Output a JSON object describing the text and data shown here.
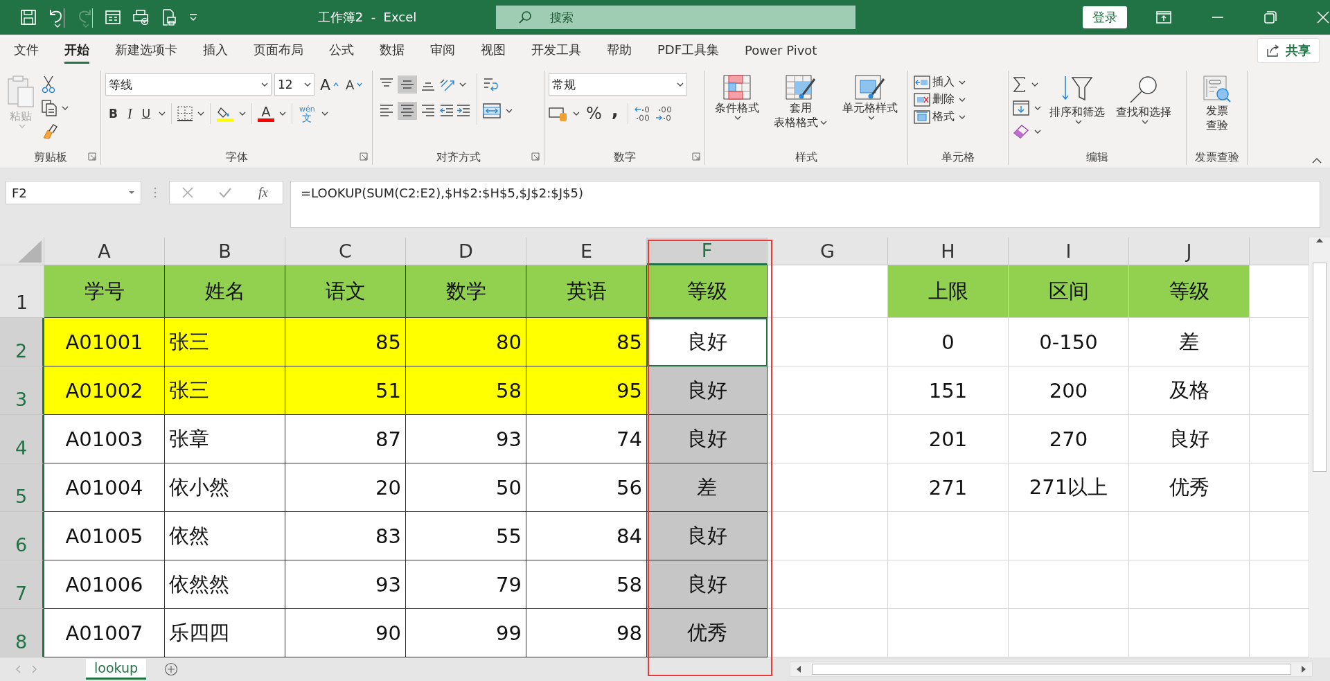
{
  "title_bar": {
    "title": "工作簿2  -  Excel",
    "search": {
      "placeholder": "搜索"
    },
    "sign_in": "登录"
  },
  "menu_tabs": [
    {
      "label": "文件",
      "selected": false
    },
    {
      "label": "开始",
      "selected": true
    },
    {
      "label": "新建选项卡",
      "selected": false
    },
    {
      "label": "插入",
      "selected": false
    },
    {
      "label": "页面布局",
      "selected": false
    },
    {
      "label": "公式",
      "selected": false
    },
    {
      "label": "数据",
      "selected": false
    },
    {
      "label": "审阅",
      "selected": false
    },
    {
      "label": "视图",
      "selected": false
    },
    {
      "label": "开发工具",
      "selected": false
    },
    {
      "label": "帮助",
      "selected": false
    },
    {
      "label": "PDF工具集",
      "selected": false
    },
    {
      "label": "Power Pivot",
      "selected": false
    }
  ],
  "share": "共享",
  "ribbon": {
    "clipboard": {
      "label": "剪贴板",
      "paste": "粘贴",
      "paste_disabled": true
    },
    "font": {
      "label": "字体",
      "font_name": "等线",
      "font_size": "12",
      "grow": "A",
      "shrink": "A",
      "bold": "B",
      "italic": "I",
      "underline": "U",
      "font_color": "A",
      "phonetic_top": "wén",
      "phonetic_bottom": "文"
    },
    "alignment": {
      "label": "对齐方式",
      "vertical": [
        {
          "selected": false
        },
        {
          "selected": true
        },
        {
          "selected": false
        }
      ],
      "horizontal": [
        {
          "selected": false
        },
        {
          "selected": true
        },
        {
          "selected": false
        }
      ]
    },
    "number": {
      "label": "数字",
      "format": "常规",
      "percent": "%",
      "comma": ","
    },
    "styles": {
      "label": "样式",
      "conditional": "条件格式",
      "table_line1": "套用",
      "table_line2": "表格格式",
      "cell_styles": "单元格样式"
    },
    "cells": {
      "label": "单元格",
      "insert": "插入",
      "delete": "删除",
      "format": "格式"
    },
    "editing": {
      "label": "编辑",
      "sort": "排序和筛选",
      "find": "查找和选择"
    },
    "invoice": {
      "label": "发票查验",
      "line1": "发票",
      "line2": "查验"
    }
  },
  "formula_bar": {
    "name_box": "F2",
    "fx": "fx",
    "formula": "=LOOKUP(SUM(C2:E2),$H$2:$H$5,$J$2:$J$5)"
  },
  "sheet": {
    "columns": [
      {
        "label": "A",
        "selected": false
      },
      {
        "label": "B",
        "selected": false
      },
      {
        "label": "C",
        "selected": false
      },
      {
        "label": "D",
        "selected": false
      },
      {
        "label": "E",
        "selected": false
      },
      {
        "label": "F",
        "selected": true
      },
      {
        "label": "G",
        "selected": false
      },
      {
        "label": "H",
        "selected": false
      },
      {
        "label": "I",
        "selected": false
      },
      {
        "label": "J",
        "selected": false
      }
    ],
    "rows": [
      {
        "number": "1",
        "selected": false,
        "cells": [
          {
            "text": "学号",
            "color": "#92d050",
            "selected": false,
            "active": false
          },
          {
            "text": "姓名",
            "color": "#92d050",
            "selected": false,
            "active": false
          },
          {
            "text": "语文",
            "color": "#92d050",
            "selected": false,
            "active": false
          },
          {
            "text": "数学",
            "color": "#92d050",
            "selected": false,
            "active": false
          },
          {
            "text": "英语",
            "color": "#92d050",
            "selected": false,
            "active": false
          },
          {
            "text": "等级",
            "color": "#92d050",
            "selected": false,
            "active": false
          },
          {
            "selected": false,
            "active": false
          },
          {
            "text": "上限",
            "color": "#92d050",
            "selected": false,
            "active": false
          },
          {
            "text": "区间",
            "color": "#92d050",
            "selected": false,
            "active": false
          },
          {
            "text": "等级",
            "color": "#92d050",
            "selected": false,
            "active": false
          }
        ]
      },
      {
        "number": "2",
        "selected": true,
        "cells": [
          {
            "text": "A01001",
            "color": "#ffff00",
            "selected": false,
            "active": false
          },
          {
            "text": "张三",
            "color": "#ffff00",
            "selected": false,
            "active": false
          },
          {
            "text": "85",
            "color": "#ffff00",
            "selected": false,
            "active": false
          },
          {
            "text": "80",
            "color": "#ffff00",
            "selected": false,
            "active": false
          },
          {
            "text": "85",
            "color": "#ffff00",
            "selected": false,
            "active": false
          },
          {
            "text": "良好",
            "selected": false,
            "active": true
          },
          {
            "selected": false,
            "active": false
          },
          {
            "text": "0",
            "selected": false,
            "active": false
          },
          {
            "text": "0-150",
            "selected": false,
            "active": false
          },
          {
            "text": "差",
            "selected": false,
            "active": false
          }
        ]
      },
      {
        "number": "3",
        "selected": true,
        "cells": [
          {
            "text": "A01002",
            "color": "#ffff00",
            "selected": false,
            "active": false
          },
          {
            "text": "张三",
            "color": "#ffff00",
            "selected": false,
            "active": false
          },
          {
            "text": "51",
            "color": "#ffff00",
            "selected": false,
            "active": false
          },
          {
            "text": "58",
            "color": "#ffff00",
            "selected": false,
            "active": false
          },
          {
            "text": "95",
            "color": "#ffff00",
            "selected": false,
            "active": false
          },
          {
            "text": "良好",
            "selected": true,
            "active": false
          },
          {
            "selected": false,
            "active": false
          },
          {
            "text": "151",
            "selected": false,
            "active": false
          },
          {
            "text": "200",
            "selected": false,
            "active": false
          },
          {
            "text": "及格",
            "selected": false,
            "active": false
          }
        ]
      },
      {
        "number": "4",
        "selected": true,
        "cells": [
          {
            "text": "A01003",
            "selected": false,
            "active": false
          },
          {
            "text": "张章",
            "selected": false,
            "active": false
          },
          {
            "text": "87",
            "selected": false,
            "active": false
          },
          {
            "text": "93",
            "selected": false,
            "active": false
          },
          {
            "text": "74",
            "selected": false,
            "active": false
          },
          {
            "text": "良好",
            "selected": true,
            "active": false
          },
          {
            "selected": false,
            "active": false
          },
          {
            "text": "201",
            "selected": false,
            "active": false
          },
          {
            "text": "270",
            "selected": false,
            "active": false
          },
          {
            "text": "良好",
            "selected": false,
            "active": false
          }
        ]
      },
      {
        "number": "5",
        "selected": true,
        "cells": [
          {
            "text": "A01004",
            "selected": false,
            "active": false
          },
          {
            "text": "依小然",
            "selected": false,
            "active": false
          },
          {
            "text": "20",
            "selected": false,
            "active": false
          },
          {
            "text": "50",
            "selected": false,
            "active": false
          },
          {
            "text": "56",
            "selected": false,
            "active": false
          },
          {
            "text": "差",
            "selected": true,
            "active": false
          },
          {
            "selected": false,
            "active": false
          },
          {
            "text": "271",
            "selected": false,
            "active": false
          },
          {
            "text": "271以上",
            "selected": false,
            "active": false
          },
          {
            "text": "优秀",
            "selected": false,
            "active": false
          }
        ]
      },
      {
        "number": "6",
        "selected": true,
        "cells": [
          {
            "text": "A01005",
            "selected": false,
            "active": false
          },
          {
            "text": "依然",
            "selected": false,
            "active": false
          },
          {
            "text": "83",
            "selected": false,
            "active": false
          },
          {
            "text": "55",
            "selected": false,
            "active": false
          },
          {
            "text": "84",
            "selected": false,
            "active": false
          },
          {
            "text": "良好",
            "selected": true,
            "active": false
          },
          {
            "selected": false,
            "active": false
          },
          {
            "selected": false,
            "active": false
          },
          {
            "selected": false,
            "active": false
          },
          {
            "selected": false,
            "active": false
          }
        ]
      },
      {
        "number": "7",
        "selected": true,
        "cells": [
          {
            "text": "A01006",
            "selected": false,
            "active": false
          },
          {
            "text": "依然然",
            "selected": false,
            "active": false
          },
          {
            "text": "93",
            "selected": false,
            "active": false
          },
          {
            "text": "79",
            "selected": false,
            "active": false
          },
          {
            "text": "58",
            "selected": false,
            "active": false
          },
          {
            "text": "良好",
            "selected": true,
            "active": false
          },
          {
            "selected": false,
            "active": false
          },
          {
            "selected": false,
            "active": false
          },
          {
            "selected": false,
            "active": false
          },
          {
            "selected": false,
            "active": false
          }
        ]
      },
      {
        "number": "8",
        "selected": true,
        "cells": [
          {
            "text": "A01007",
            "selected": false,
            "active": false
          },
          {
            "text": "乐四四",
            "selected": false,
            "active": false
          },
          {
            "text": "90",
            "selected": false,
            "active": false
          },
          {
            "text": "99",
            "selected": false,
            "active": false
          },
          {
            "text": "98",
            "selected": false,
            "active": false
          },
          {
            "text": "优秀",
            "selected": true,
            "active": false
          },
          {
            "selected": false,
            "active": false
          },
          {
            "selected": false,
            "active": false
          },
          {
            "selected": false,
            "active": false
          },
          {
            "selected": false,
            "active": false
          }
        ]
      }
    ]
  },
  "sheet_tabs": [
    {
      "label": "lookup",
      "selected": true
    }
  ]
}
